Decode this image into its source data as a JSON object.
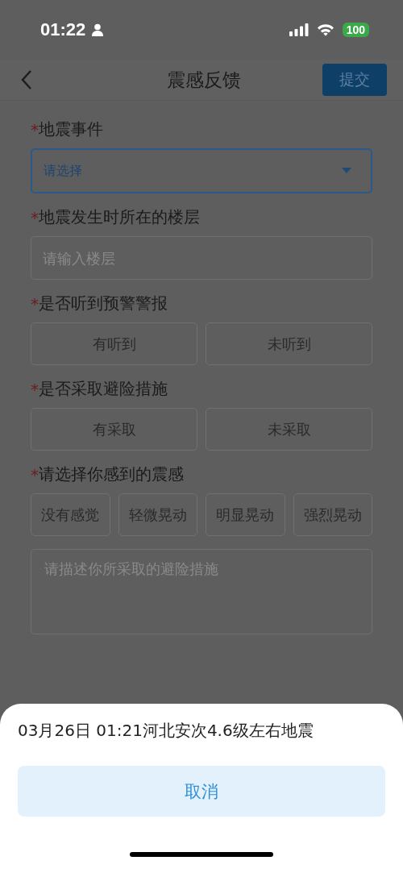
{
  "status_bar": {
    "time": "01:22",
    "battery": "100"
  },
  "header": {
    "title": "震感反馈",
    "submit": "提交"
  },
  "fields": [
    {
      "kind": "select",
      "mark": "*",
      "label": "地震事件",
      "placeholder": "请选择"
    },
    {
      "kind": "input",
      "mark": "*",
      "label": "地震发生时所在的楼层",
      "placeholder": "请输入楼层"
    },
    {
      "kind": "choice",
      "mark": "*",
      "label": "是否听到预警警报",
      "options": [
        {
          "label": "有听到",
          "selected": false
        },
        {
          "label": "未听到",
          "selected": false
        }
      ]
    },
    {
      "kind": "choice",
      "mark": "*",
      "label": "是否采取避险措施",
      "options": [
        {
          "label": "有采取",
          "selected": false
        },
        {
          "label": "未采取",
          "selected": false
        }
      ]
    },
    {
      "kind": "choice",
      "mark": "*",
      "label": "请选择你感到的震感",
      "options": [
        {
          "label": "没有感觉",
          "selected": false
        },
        {
          "label": "轻微晃动",
          "selected": false
        },
        {
          "label": "明显晃动",
          "selected": false
        },
        {
          "label": "强烈晃动",
          "selected": false
        }
      ]
    },
    {
      "kind": "textarea",
      "placeholder": "请描述你所采取的避险措施"
    }
  ],
  "sheet": {
    "event": "03月26日 01:21河北安次4.6级左右地震",
    "cancel": "取消"
  }
}
